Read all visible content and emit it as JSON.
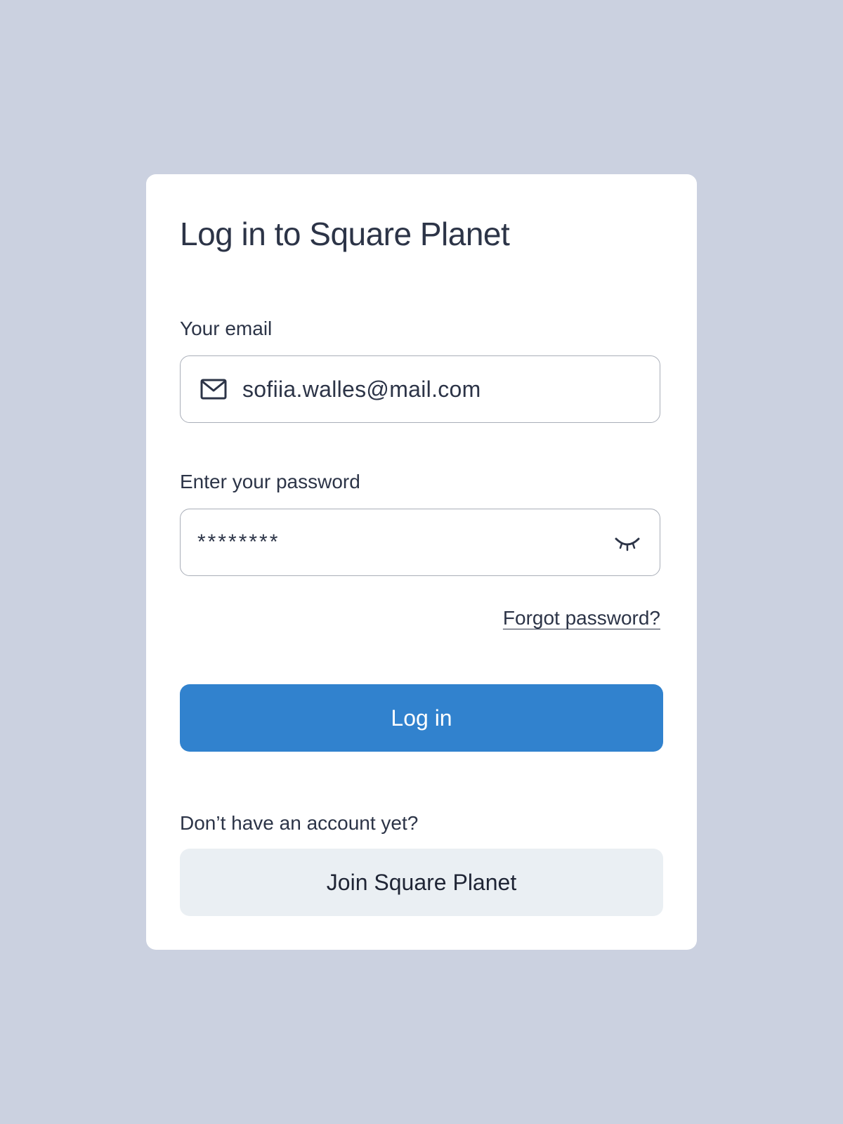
{
  "login": {
    "title": "Log in to Square Planet",
    "email": {
      "label": "Your email",
      "value": "sofiia.walles@mail.com",
      "icon": "mail-icon"
    },
    "password": {
      "label": "Enter your password",
      "value": "********",
      "icon": "eye-closed-icon"
    },
    "forgot_label": "Forgot password?",
    "login_label": "Log in",
    "no_account_text": "Don’t have an account yet?",
    "join_label": "Join Square Planet"
  },
  "colors": {
    "background": "#cbd1e0",
    "card": "#ffffff",
    "primary": "#3182ce",
    "secondary_button": "#eaeff3",
    "text": "#2c3447"
  }
}
